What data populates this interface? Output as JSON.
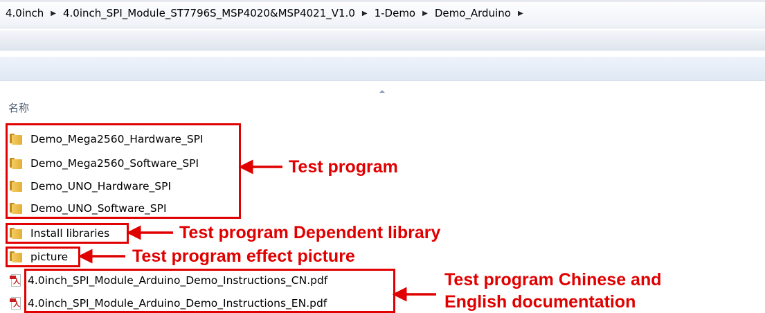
{
  "breadcrumb": [
    "4.0inch",
    "4.0inch_SPI_Module_ST7796S_MSP4020&MSP4021_V1.0",
    "1-Demo",
    "Demo_Arduino"
  ],
  "column_header": "名称",
  "files": [
    {
      "name": "Demo_Mega2560_Hardware_SPI",
      "type": "folder",
      "icon": "folder-icon"
    },
    {
      "name": "Demo_Mega2560_Software_SPI",
      "type": "folder",
      "icon": "folder-icon"
    },
    {
      "name": "Demo_UNO_Hardware_SPI",
      "type": "folder",
      "icon": "folder-icon"
    },
    {
      "name": "Demo_UNO_Software_SPI",
      "type": "folder",
      "icon": "folder-icon"
    },
    {
      "name": "Install libraries",
      "type": "folder",
      "icon": "folder-icon"
    },
    {
      "name": "picture",
      "type": "folder",
      "icon": "folder-icon"
    },
    {
      "name": "4.0inch_SPI_Module_Arduino_Demo_Instructions_CN.pdf",
      "type": "pdf",
      "icon": "pdf-icon"
    },
    {
      "name": "4.0inch_SPI_Module_Arduino_Demo_Instructions_EN.pdf",
      "type": "pdf",
      "icon": "pdf-icon"
    }
  ],
  "annotations": {
    "test_program": "Test program",
    "dependent_library": "Test program Dependent library",
    "effect_picture": "Test program effect picture",
    "documentation_line1": "Test program Chinese and",
    "documentation_line2": "English documentation"
  },
  "colors": {
    "annotation": "#e00000",
    "folder": "#e9b33f",
    "header_text": "#4a5b70"
  }
}
